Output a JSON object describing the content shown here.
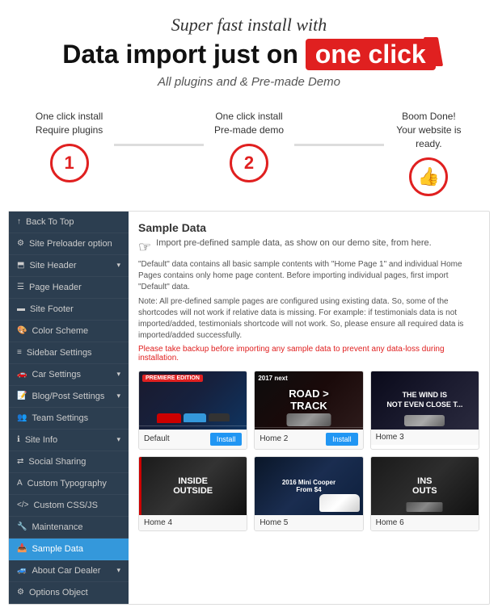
{
  "header": {
    "super_fast": "Super fast install with",
    "main_title_pre": "Data import just on",
    "main_title_highlight": "one click",
    "subtitle": "All plugins and & Pre-made Demo"
  },
  "steps": [
    {
      "text_line1": "One click install",
      "text_line2": "Require plugins",
      "number": "1"
    },
    {
      "text_line1": "One click install",
      "text_line2": "Pre-made demo",
      "number": "2"
    },
    {
      "text_line1": "Boom Done!",
      "text_line2": "Your website is ready.",
      "icon": "👍"
    }
  ],
  "sidebar": {
    "items": [
      {
        "icon": "↑",
        "label": "Back To Top",
        "hasArrow": false
      },
      {
        "icon": "⚙",
        "label": "Site Preloader option",
        "hasArrow": false
      },
      {
        "icon": "⬒",
        "label": "Site Header",
        "hasArrow": true
      },
      {
        "icon": "☰",
        "label": "Page Header",
        "hasArrow": false
      },
      {
        "icon": "▬",
        "label": "Site Footer",
        "hasArrow": false
      },
      {
        "icon": "🎨",
        "label": "Color Scheme",
        "hasArrow": false
      },
      {
        "icon": "≡",
        "label": "Sidebar Settings",
        "hasArrow": false
      },
      {
        "icon": "🚗",
        "label": "Car Settings",
        "hasArrow": true
      },
      {
        "icon": "📝",
        "label": "Blog/Post Settings",
        "hasArrow": true
      },
      {
        "icon": "👥",
        "label": "Team Settings",
        "hasArrow": false
      },
      {
        "icon": "ℹ",
        "label": "Site Info",
        "hasArrow": true
      },
      {
        "icon": "⇄",
        "label": "Social Sharing",
        "hasArrow": false
      },
      {
        "icon": "A",
        "label": "Custom Typography",
        "hasArrow": false
      },
      {
        "icon": "</>",
        "label": "Custom CSS/JS",
        "hasArrow": false
      },
      {
        "icon": "🔧",
        "label": "Maintenance",
        "hasArrow": false
      },
      {
        "icon": "📥",
        "label": "Sample Data",
        "hasArrow": false,
        "active": true
      },
      {
        "icon": "🚙",
        "label": "About Car Dealer",
        "hasArrow": true
      },
      {
        "icon": "⚙",
        "label": "Options Object",
        "hasArrow": false
      }
    ]
  },
  "content": {
    "title": "Sample Data",
    "desc": "Import pre-defined sample data, as show on our demo site, from here.",
    "note": "\"Default\" data contains all basic sample contents with \"Home Page 1\" and individual Home Pages contains only home page content. Before importing individual pages, first import \"Default\" data.",
    "note2": "Note: All pre-defined sample pages are configured using existing data. So, some of the shortcodes will not work if relative data is missing. For example: if testimonials data is not imported/added, testimonials shortcode will not work. So, please ensure all required data is imported/added successfully.",
    "warning": "Please take backup before importing any sample data to prevent any data-loss during installation.",
    "demos": [
      {
        "name": "Default",
        "label": "Default",
        "type": "default",
        "has_install": true
      },
      {
        "name": "Home 2",
        "label": "Home 2",
        "type": "home2",
        "has_install": true
      },
      {
        "name": "Home 3",
        "label": "Home 3",
        "type": "home3",
        "has_install": false
      },
      {
        "name": "Home 4",
        "label": "Home 4",
        "type": "home4",
        "has_install": false
      },
      {
        "name": "Home 5",
        "label": "Home 5",
        "type": "home5",
        "has_install": false
      },
      {
        "name": "Home 6",
        "label": "Home 6",
        "type": "home6",
        "has_install": false
      }
    ]
  },
  "buttons": {
    "install": "Install"
  }
}
